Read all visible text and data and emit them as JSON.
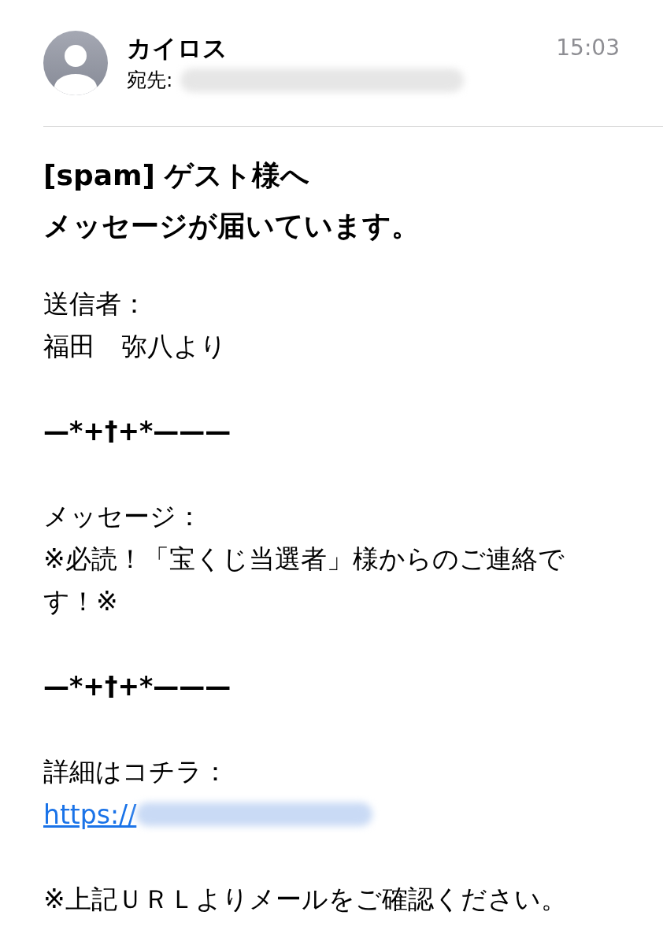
{
  "header": {
    "sender": "カイロス",
    "recipient_label": "宛先:",
    "time": "15:03"
  },
  "subject": [
    "[spam] ゲスト様へ",
    "メッセージが届いています。"
  ],
  "body": [
    {
      "lines": [
        {
          "kind": "text",
          "text": "送信者："
        },
        {
          "kind": "text",
          "text": "福田　弥八より"
        }
      ]
    },
    {
      "lines": [
        {
          "kind": "divider",
          "text": "—*+†+*———"
        }
      ]
    },
    {
      "lines": [
        {
          "kind": "text",
          "text": "メッセージ："
        },
        {
          "kind": "text",
          "text": "※必読！「宝くじ当選者」様からのご連絡です！※"
        }
      ]
    },
    {
      "lines": [
        {
          "kind": "divider",
          "text": "—*+†+*———"
        }
      ]
    },
    {
      "lines": [
        {
          "kind": "text",
          "text": "詳細はコチラ："
        },
        {
          "kind": "link",
          "text": "https://"
        }
      ]
    },
    {
      "lines": [
        {
          "kind": "text",
          "text": "※上記ＵＲＬよりメールをご確認ください。"
        }
      ]
    }
  ]
}
